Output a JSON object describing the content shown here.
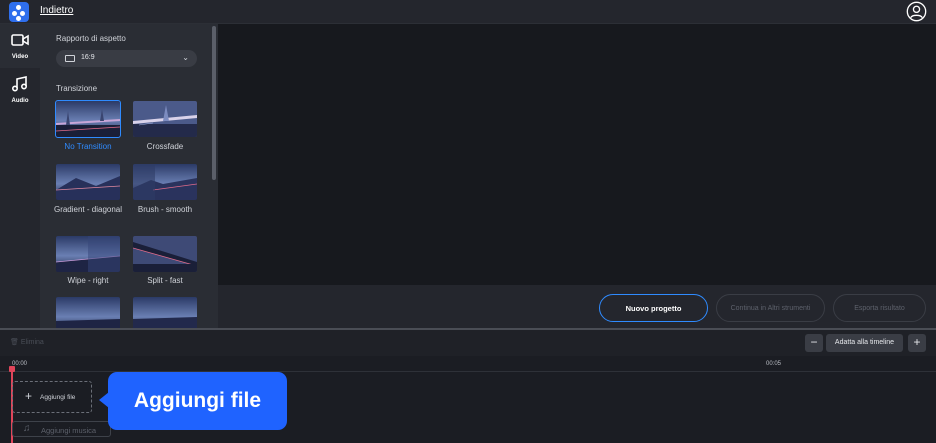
{
  "header": {
    "back_label": "Indietro"
  },
  "nav": {
    "items": [
      {
        "label": "Video",
        "icon": "video-camera-icon"
      },
      {
        "label": "Audio",
        "icon": "music-note-icon"
      }
    ]
  },
  "panel": {
    "aspect_title": "Rapporto di aspetto",
    "aspect_value": "16:9",
    "transition_title": "Transizione",
    "transitions": [
      {
        "label": "No Transition",
        "selected": true
      },
      {
        "label": "Crossfade"
      },
      {
        "label": "Gradient - diagonal"
      },
      {
        "label": "Brush - smooth"
      },
      {
        "label": "Wipe - right"
      },
      {
        "label": "Split - fast"
      }
    ]
  },
  "actions": {
    "new_project": "Nuovo progetto",
    "continue_other": "Continua in Altri strumenti",
    "export": "Esporta risultato"
  },
  "timeline": {
    "delete_label": "Elimina",
    "zoom_out": "−",
    "fit_label": "Adatta alla timeline",
    "zoom_in": "+",
    "time_start": "00:00",
    "time_mark": "00:05",
    "add_file": "Aggiungi file",
    "add_music": "Aggiungi musica"
  },
  "callout": {
    "text": "Aggiungi file"
  },
  "colors": {
    "accent": "#2f8bff",
    "callout": "#1f63ff",
    "playhead": "#e0455a"
  }
}
